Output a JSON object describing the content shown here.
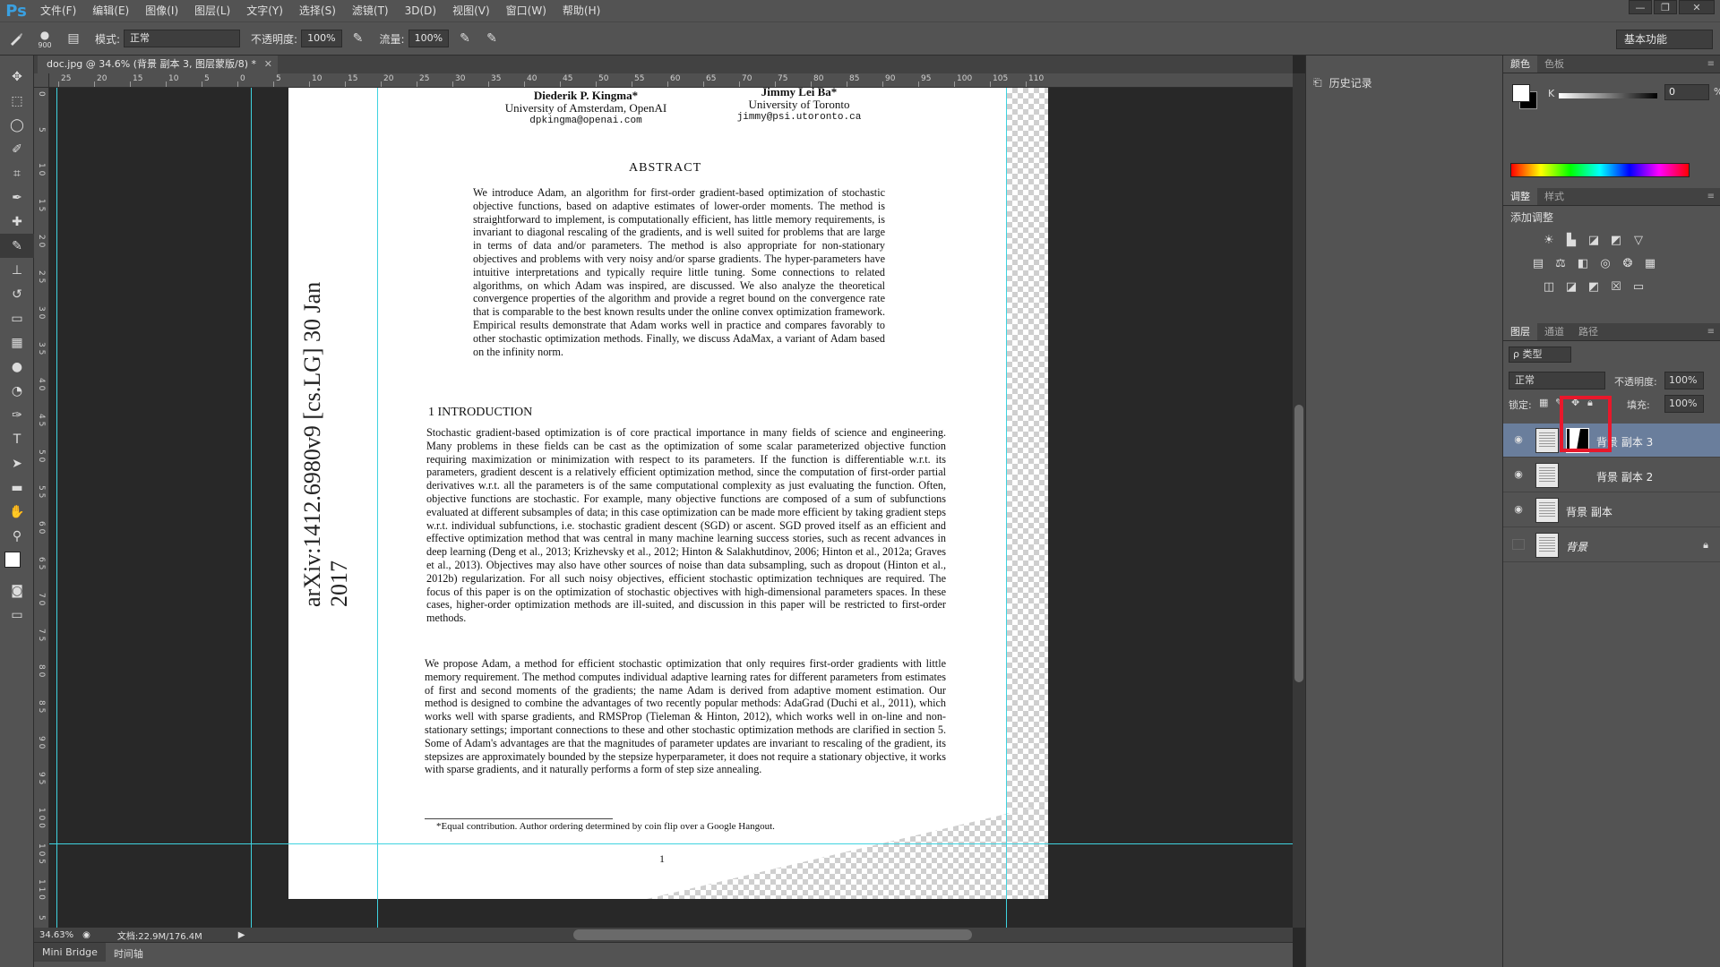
{
  "app": {
    "logo": "Ps"
  },
  "menu": [
    "文件(F)",
    "编辑(E)",
    "图像(I)",
    "图层(L)",
    "文字(Y)",
    "选择(S)",
    "滤镜(T)",
    "3D(D)",
    "视图(V)",
    "窗口(W)",
    "帮助(H)"
  ],
  "window_controls": [
    "—",
    "❐",
    "✕"
  ],
  "options": {
    "brush_size": "900",
    "mode_label": "模式:",
    "mode_value": "正常",
    "opacity_label": "不透明度:",
    "opacity_value": "100%",
    "flow_label": "流量:",
    "flow_value": "100%",
    "workspace": "基本功能"
  },
  "document": {
    "tab_title": "doc.jpg @ 34.6% (背景 副本 3, 图层蒙版/8) *",
    "close": "✕",
    "zoom": "34.63%",
    "doc_size": "文档:22.9M/176.4M"
  },
  "ruler_top_labels": [
    "25",
    "20",
    "15",
    "10",
    "5",
    "0",
    "5",
    "10",
    "15",
    "20",
    "25",
    "30",
    "35",
    "40",
    "45",
    "50",
    "55",
    "60",
    "65",
    "70",
    "75",
    "80",
    "85",
    "90",
    "95",
    "100",
    "105",
    "110"
  ],
  "ruler_left_labels": [
    "0",
    "5",
    "1 0",
    "1 5",
    "2 0",
    "2 5",
    "3 0",
    "3 5",
    "4 0",
    "4 5",
    "5 0",
    "5 5",
    "6 0",
    "6 5",
    "7 0",
    "7 5",
    "8 0",
    "8 5",
    "9 0",
    "9 5",
    "1 0 0",
    "1 0 5",
    "1 1 0",
    "1 1 5"
  ],
  "paper": {
    "author1_name": "Diederik P. Kingma*",
    "author1_affil": "University of Amsterdam, OpenAI",
    "author1_email": "dpkingma@openai.com",
    "author2_name": "Jimmy Lei Ba*",
    "author2_affil": "University of Toronto",
    "author2_email": "jimmy@psi.utoronto.ca",
    "abstract_title": "ABSTRACT",
    "abstract": "We introduce Adam, an algorithm for first-order gradient-based optimization of stochastic objective functions, based on adaptive estimates of lower-order moments. The method is straightforward to implement, is computationally efficient, has little memory requirements, is invariant to diagonal rescaling of the gradients, and is well suited for problems that are large in terms of data and/or parameters. The method is also appropriate for non-stationary objectives and problems with very noisy and/or sparse gradients. The hyper-parameters have intuitive interpretations and typically require little tuning. Some connections to related algorithms, on which Adam was inspired, are discussed. We also analyze the theoretical convergence properties of the algorithm and provide a regret bound on the convergence rate that is comparable to the best known results under the online convex optimization framework. Empirical results demonstrate that Adam works well in practice and compares favorably to other stochastic optimization methods. Finally, we discuss AdaMax, a variant of Adam based on the infinity norm.",
    "arxiv_stamp": "arXiv:1412.6980v9  [cs.LG]  30 Jan 2017",
    "intro_title": "1   INTRODUCTION",
    "intro_p1": "Stochastic gradient-based optimization is of core practical importance in many fields of science and engineering. Many problems in these fields can be cast as the optimization of some scalar parameterized objective function requiring maximization or minimization with respect to its parameters. If the function is differentiable w.r.t. its parameters, gradient descent is a relatively efficient optimization method, since the computation of first-order partial derivatives w.r.t. all the parameters is of the same computational complexity as just evaluating the function. Often, objective functions are stochastic. For example, many objective functions are composed of a sum of subfunctions evaluated at different subsamples of data; in this case optimization can be made more efficient by taking gradient steps w.r.t. individual subfunctions, i.e. stochastic gradient descent (SGD) or ascent. SGD proved itself as an efficient and effective optimization method that was central in many machine learning success stories, such as recent advances in deep learning (Deng et al., 2013; Krizhevsky et al., 2012; Hinton & Salakhutdinov, 2006; Hinton et al., 2012a; Graves et al., 2013). Objectives may also have other sources of noise than data subsampling, such as dropout (Hinton et al., 2012b) regularization. For all such noisy objectives, efficient stochastic optimization techniques are required. The focus of this paper is on the optimization of stochastic objectives with high-dimensional parameters spaces. In these cases, higher-order optimization methods are ill-suited, and discussion in this paper will be restricted to first-order methods.",
    "intro_p2": "We propose Adam, a method for efficient stochastic optimization that only requires first-order gradients with little memory requirement. The method computes individual adaptive learning rates for different parameters from estimates of first and second moments of the gradients; the name Adam is derived from adaptive moment estimation. Our method is designed to combine the advantages of two recently popular methods: AdaGrad (Duchi et al., 2011), which works well with sparse gradients, and RMSProp (Tieleman & Hinton, 2012), which works well in on-line and non-stationary settings; important connections to these and other stochastic optimization methods are clarified in section 5. Some of Adam's advantages are that the magnitudes of parameter updates are invariant to rescaling of the gradient, its stepsizes are approximately bounded by the stepsize hyperparameter, it does not require a stationary objective, it works with sparse gradients, and it naturally performs a form of step size annealing.",
    "footnote": "*Equal contribution. Author ordering determined by coin flip over a Google Hangout.",
    "page_number": "1"
  },
  "bottom_tabs": [
    "Mini Bridge",
    "时间轴"
  ],
  "history_panel": {
    "label": "历史记录"
  },
  "color_panel": {
    "tabs": [
      "颜色",
      "色板"
    ],
    "channel": "K",
    "value": "0",
    "unit": "%"
  },
  "adjust_panel": {
    "tabs": [
      "调整",
      "样式"
    ],
    "title": "添加调整"
  },
  "layers_panel": {
    "tabs": [
      "图层",
      "通道",
      "路径"
    ],
    "filter": "ρ 类型",
    "blend_mode": "正常",
    "opacity_label": "不透明度:",
    "opacity_value": "100%",
    "lock_label": "锁定:",
    "fill_label": "填充:",
    "fill_value": "100%",
    "layers": [
      {
        "name": "背景 副本 3",
        "selected": true,
        "visible": true,
        "has_mask": true,
        "locked": false
      },
      {
        "name": "背景 副本 2",
        "selected": false,
        "visible": true,
        "has_mask": false,
        "locked": false
      },
      {
        "name": "背景 副本",
        "selected": false,
        "visible": true,
        "has_mask": false,
        "locked": false
      },
      {
        "name": "背景",
        "selected": false,
        "visible": false,
        "has_mask": false,
        "locked": true
      }
    ]
  },
  "colors": {
    "accent_guide": "#3fd3e0",
    "highlight": "#e8182b",
    "ps_blue": "#3aa0e0"
  }
}
